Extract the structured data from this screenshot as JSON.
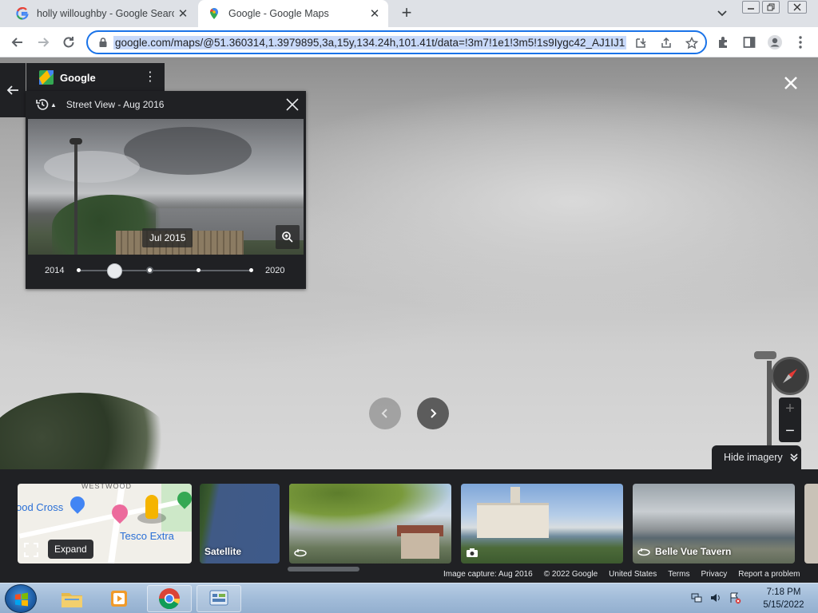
{
  "browser": {
    "tabs": [
      {
        "title": "holly willoughby - Google Search",
        "favicon": "google-g-icon",
        "active": false
      },
      {
        "title": "Google - Google Maps",
        "favicon": "google-maps-pin-icon",
        "active": true
      }
    ],
    "new_tab_label": "+",
    "url": "google.com/maps/@51.360314,1.3979895,3a,15y,134.24h,101.41t/data=!3m7!1e1!3m5!1s9Iygc42_AJ1IJ1"
  },
  "maps": {
    "brand": "Google",
    "street_view": {
      "title": "Street View - Aug 2016",
      "thumbnail_date": "Jul 2015",
      "timeline": {
        "start_year": "2014",
        "end_year": "2020"
      }
    },
    "hide_imagery_label": "Hide imagery",
    "cards": [
      {
        "type": "map",
        "labels": [
          "WESTWOOD",
          "ood Cross",
          "Tesco Extra"
        ],
        "action_label": "Expand"
      },
      {
        "type": "satellite",
        "label": "Satellite"
      },
      {
        "type": "photo-360",
        "label": ""
      },
      {
        "type": "photo",
        "label": ""
      },
      {
        "type": "photo-360",
        "label": "Belle Vue Tavern"
      }
    ],
    "footer": {
      "capture": "Image capture: Aug 2016",
      "copyright": "© 2022 Google",
      "country": "United States",
      "terms": "Terms",
      "privacy": "Privacy",
      "report": "Report a problem"
    }
  },
  "taskbar": {
    "time": "7:18 PM",
    "date": "5/15/2022"
  },
  "colors": {
    "omnibox_focus": "#1a73e8",
    "url_selection": "#c8d9f9",
    "maps_panel": "#202124",
    "taskbar": "#a2bcd9"
  }
}
